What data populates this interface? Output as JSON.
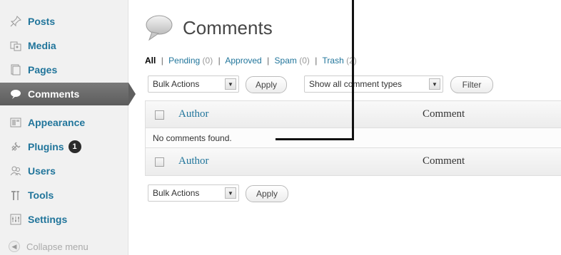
{
  "sidebar": {
    "items": [
      {
        "label": "Posts",
        "icon": "pushpin-icon"
      },
      {
        "label": "Media",
        "icon": "media-icon"
      },
      {
        "label": "Pages",
        "icon": "pages-icon"
      },
      {
        "label": "Comments",
        "icon": "speech-bubble-icon",
        "active": true
      },
      {
        "label": "Appearance",
        "icon": "appearance-icon"
      },
      {
        "label": "Plugins",
        "icon": "plug-icon",
        "badge": "1"
      },
      {
        "label": "Users",
        "icon": "users-icon"
      },
      {
        "label": "Tools",
        "icon": "tools-icon"
      },
      {
        "label": "Settings",
        "icon": "settings-icon"
      }
    ],
    "collapse_label": "Collapse menu"
  },
  "header": {
    "title": "Comments"
  },
  "filters": {
    "all": "All",
    "pending": "Pending",
    "pending_count": "(0)",
    "approved": "Approved",
    "spam": "Spam",
    "spam_count": "(0)",
    "trash": "Trash",
    "trash_count": "(2)",
    "separator": "|"
  },
  "top_controls": {
    "bulk_actions": "Bulk Actions",
    "apply": "Apply",
    "comment_types": "Show all comment types",
    "filter": "Filter"
  },
  "table": {
    "col_author": "Author",
    "col_comment": "Comment",
    "empty_message": "No comments found."
  },
  "bottom_controls": {
    "bulk_actions": "Bulk Actions",
    "apply": "Apply"
  },
  "colors": {
    "link": "#21759b",
    "active_menu": "#6d6d6d",
    "annotation": "#111111"
  }
}
